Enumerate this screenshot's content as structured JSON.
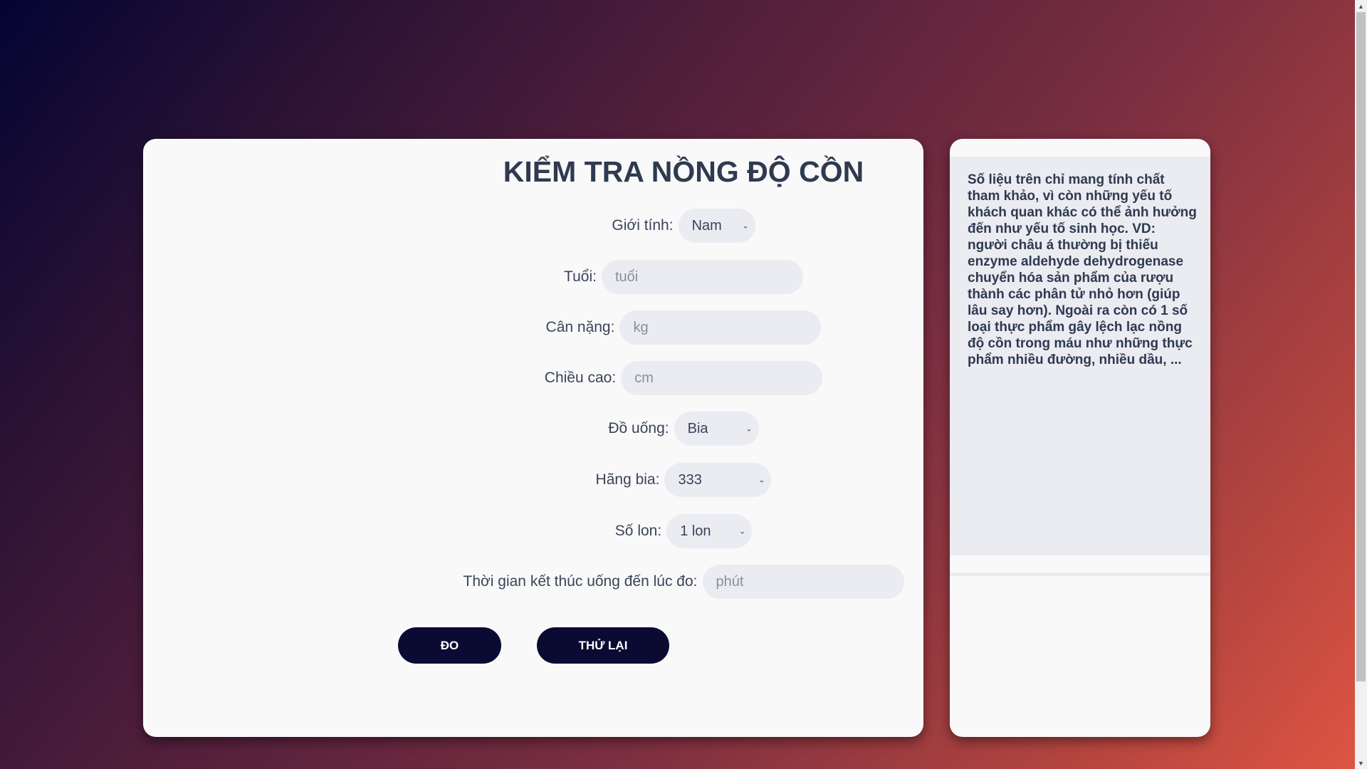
{
  "form": {
    "title": "KIỂM TRA NỒNG ĐỘ CỒN",
    "gender": {
      "label": "Giới tính:",
      "value": "Nam"
    },
    "age": {
      "label": "Tuổi:",
      "placeholder": "tuổi",
      "value": ""
    },
    "weight": {
      "label": "Cân nặng:",
      "placeholder": "kg",
      "value": ""
    },
    "height": {
      "label": "Chiều cao:",
      "placeholder": "cm",
      "value": ""
    },
    "drink": {
      "label": "Đồ uống:",
      "value": "Bia"
    },
    "brand": {
      "label": "Hãng bia:",
      "value": "333"
    },
    "cans": {
      "label": "Số lon:",
      "value": "1 lon"
    },
    "elapsed": {
      "label": "Thời gian kết thúc uống đến lúc đo:",
      "placeholder": "phút",
      "value": ""
    },
    "measure_button": "ĐO",
    "retry_button": "THỬ LẠI"
  },
  "note": {
    "text": "Số liệu trên chỉ mang tính chất tham khảo, vì còn những yếu tố khách quan khác có thể ảnh hưởng đến như yếu tố sinh học. VD: người châu á thường bị thiếu enzyme aldehyde dehydrogenase chuyển hóa sản phẩm của rượu thành các phân tử nhỏ hơn (giúp lâu say hơn). Ngoài ra còn có 1 số loại thực phẩm gây lệch lạc nồng độ cồn trong máu như những thực phẩm nhiều đường, nhiều dầu, ..."
  },
  "icons": {
    "dropdown": "chevron-down-icon",
    "scroll_up": "scroll-up-arrow-icon",
    "scroll_down": "scroll-down-arrow-icon"
  },
  "colors": {
    "button_bg": "#0a0a33",
    "field_bg": "#ebebf2",
    "title_text": "#2e3a4f"
  }
}
